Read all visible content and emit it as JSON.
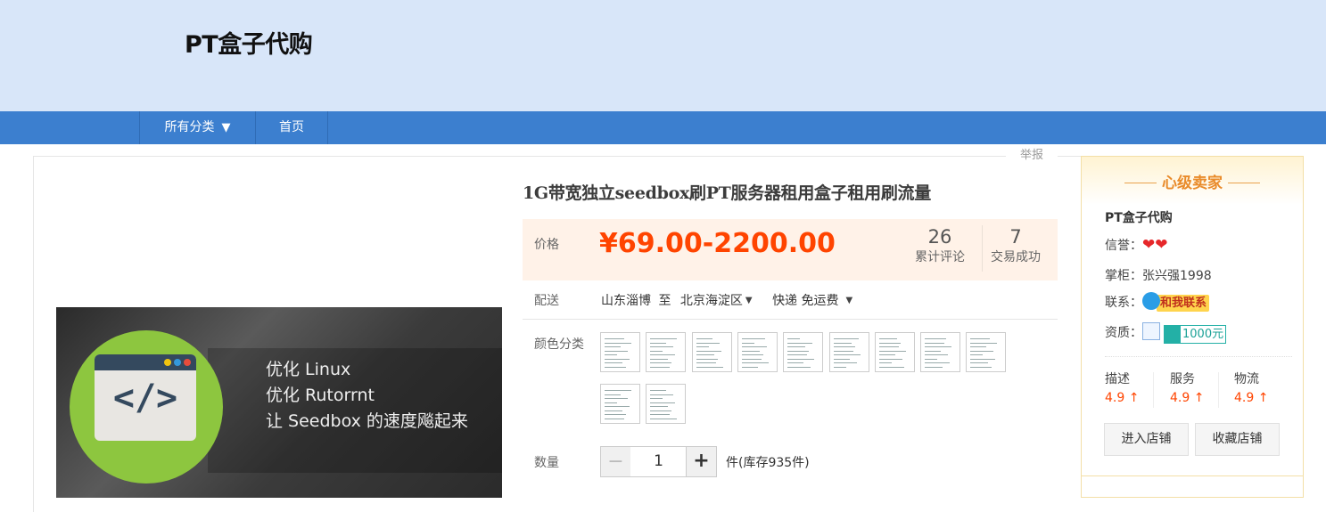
{
  "header": {
    "shop_title": "PT盒子代购"
  },
  "nav": {
    "all_categories": "所有分类",
    "home": "首页"
  },
  "report": "举报",
  "product": {
    "title": "1G带宽独立seedbox刷PT服务器租用盒子租用刷流量",
    "image": {
      "lines": [
        "优化 Linux",
        "优化 Rutorrnt",
        "让 Seedbox 的速度飚起来"
      ]
    },
    "price_label": "价格",
    "price": "¥69.00-2200.00",
    "reviews": {
      "count": "26",
      "label": "累计评论"
    },
    "sales": {
      "count": "7",
      "label": "交易成功"
    },
    "delivery": {
      "label": "配送",
      "from": "山东淄博",
      "to_word": "至",
      "to": "北京海淀区",
      "shipping": "快递 免运费"
    },
    "color": {
      "label": "颜色分类",
      "option_count": 11
    },
    "quantity": {
      "label": "数量",
      "minus": "−",
      "value": "1",
      "plus": "+",
      "stock": "件(库存935件)"
    }
  },
  "seller": {
    "rank": "心级卖家",
    "name": "PT盒子代购",
    "reputation_label": "信誉：",
    "reputation_hearts": "❤❤",
    "keeper_label": "掌柜：",
    "keeper": "张兴强1998",
    "contact_label": "联系：",
    "contact_button": "和我联系",
    "qualification_label": "资质：",
    "deposit": "1000元",
    "dsr": [
      {
        "label": "描述",
        "value": "4.9 ↑"
      },
      {
        "label": "服务",
        "value": "4.9 ↑"
      },
      {
        "label": "物流",
        "value": "4.9 ↑"
      }
    ],
    "enter_shop": "进入店铺",
    "favorite_shop": "收藏店铺"
  },
  "colors": {
    "nav_bg": "#3c7fcf",
    "banner_bg": "#d8e6f9",
    "price": "#ff4400",
    "seller_accent": "#e98b2a"
  }
}
